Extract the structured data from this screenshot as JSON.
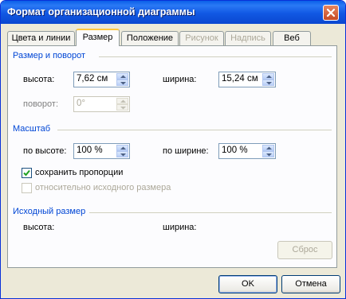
{
  "window": {
    "title": "Формат организационной диаграммы",
    "close_icon": "close-icon"
  },
  "tabs": [
    {
      "label": "Цвета и линии",
      "state": "normal"
    },
    {
      "label": "Размер",
      "state": "active"
    },
    {
      "label": "Положение",
      "state": "normal"
    },
    {
      "label": "Рисунок",
      "state": "disabled"
    },
    {
      "label": "Надпись",
      "state": "disabled"
    },
    {
      "label": "Веб",
      "state": "normal"
    }
  ],
  "size_rotate": {
    "title": "Размер и поворот",
    "height_label": "высота:",
    "height_value": "7,62 см",
    "width_label": "ширина:",
    "width_value": "15,24 см",
    "rotation_label": "поворот:",
    "rotation_value": "0°"
  },
  "scale": {
    "title": "Масштаб",
    "by_height_label": "по высоте:",
    "by_height_value": "100 %",
    "by_width_label": "по ширине:",
    "by_width_value": "100 %",
    "keep_proportions_label": "сохранить пропорции",
    "keep_proportions_checked": true,
    "relative_label": "относительно исходного размера",
    "relative_checked": false
  },
  "original_size": {
    "title": "Исходный размер",
    "height_label": "высота:",
    "width_label": "ширина:",
    "reset_label": "Сброс"
  },
  "buttons": {
    "ok": "OK",
    "cancel": "Отмена"
  },
  "colors": {
    "title_bar": "#0a5fe8",
    "group_title": "#0046d5",
    "dialog_bg": "#ece9d8",
    "panel_bg": "#fcfcfe"
  }
}
